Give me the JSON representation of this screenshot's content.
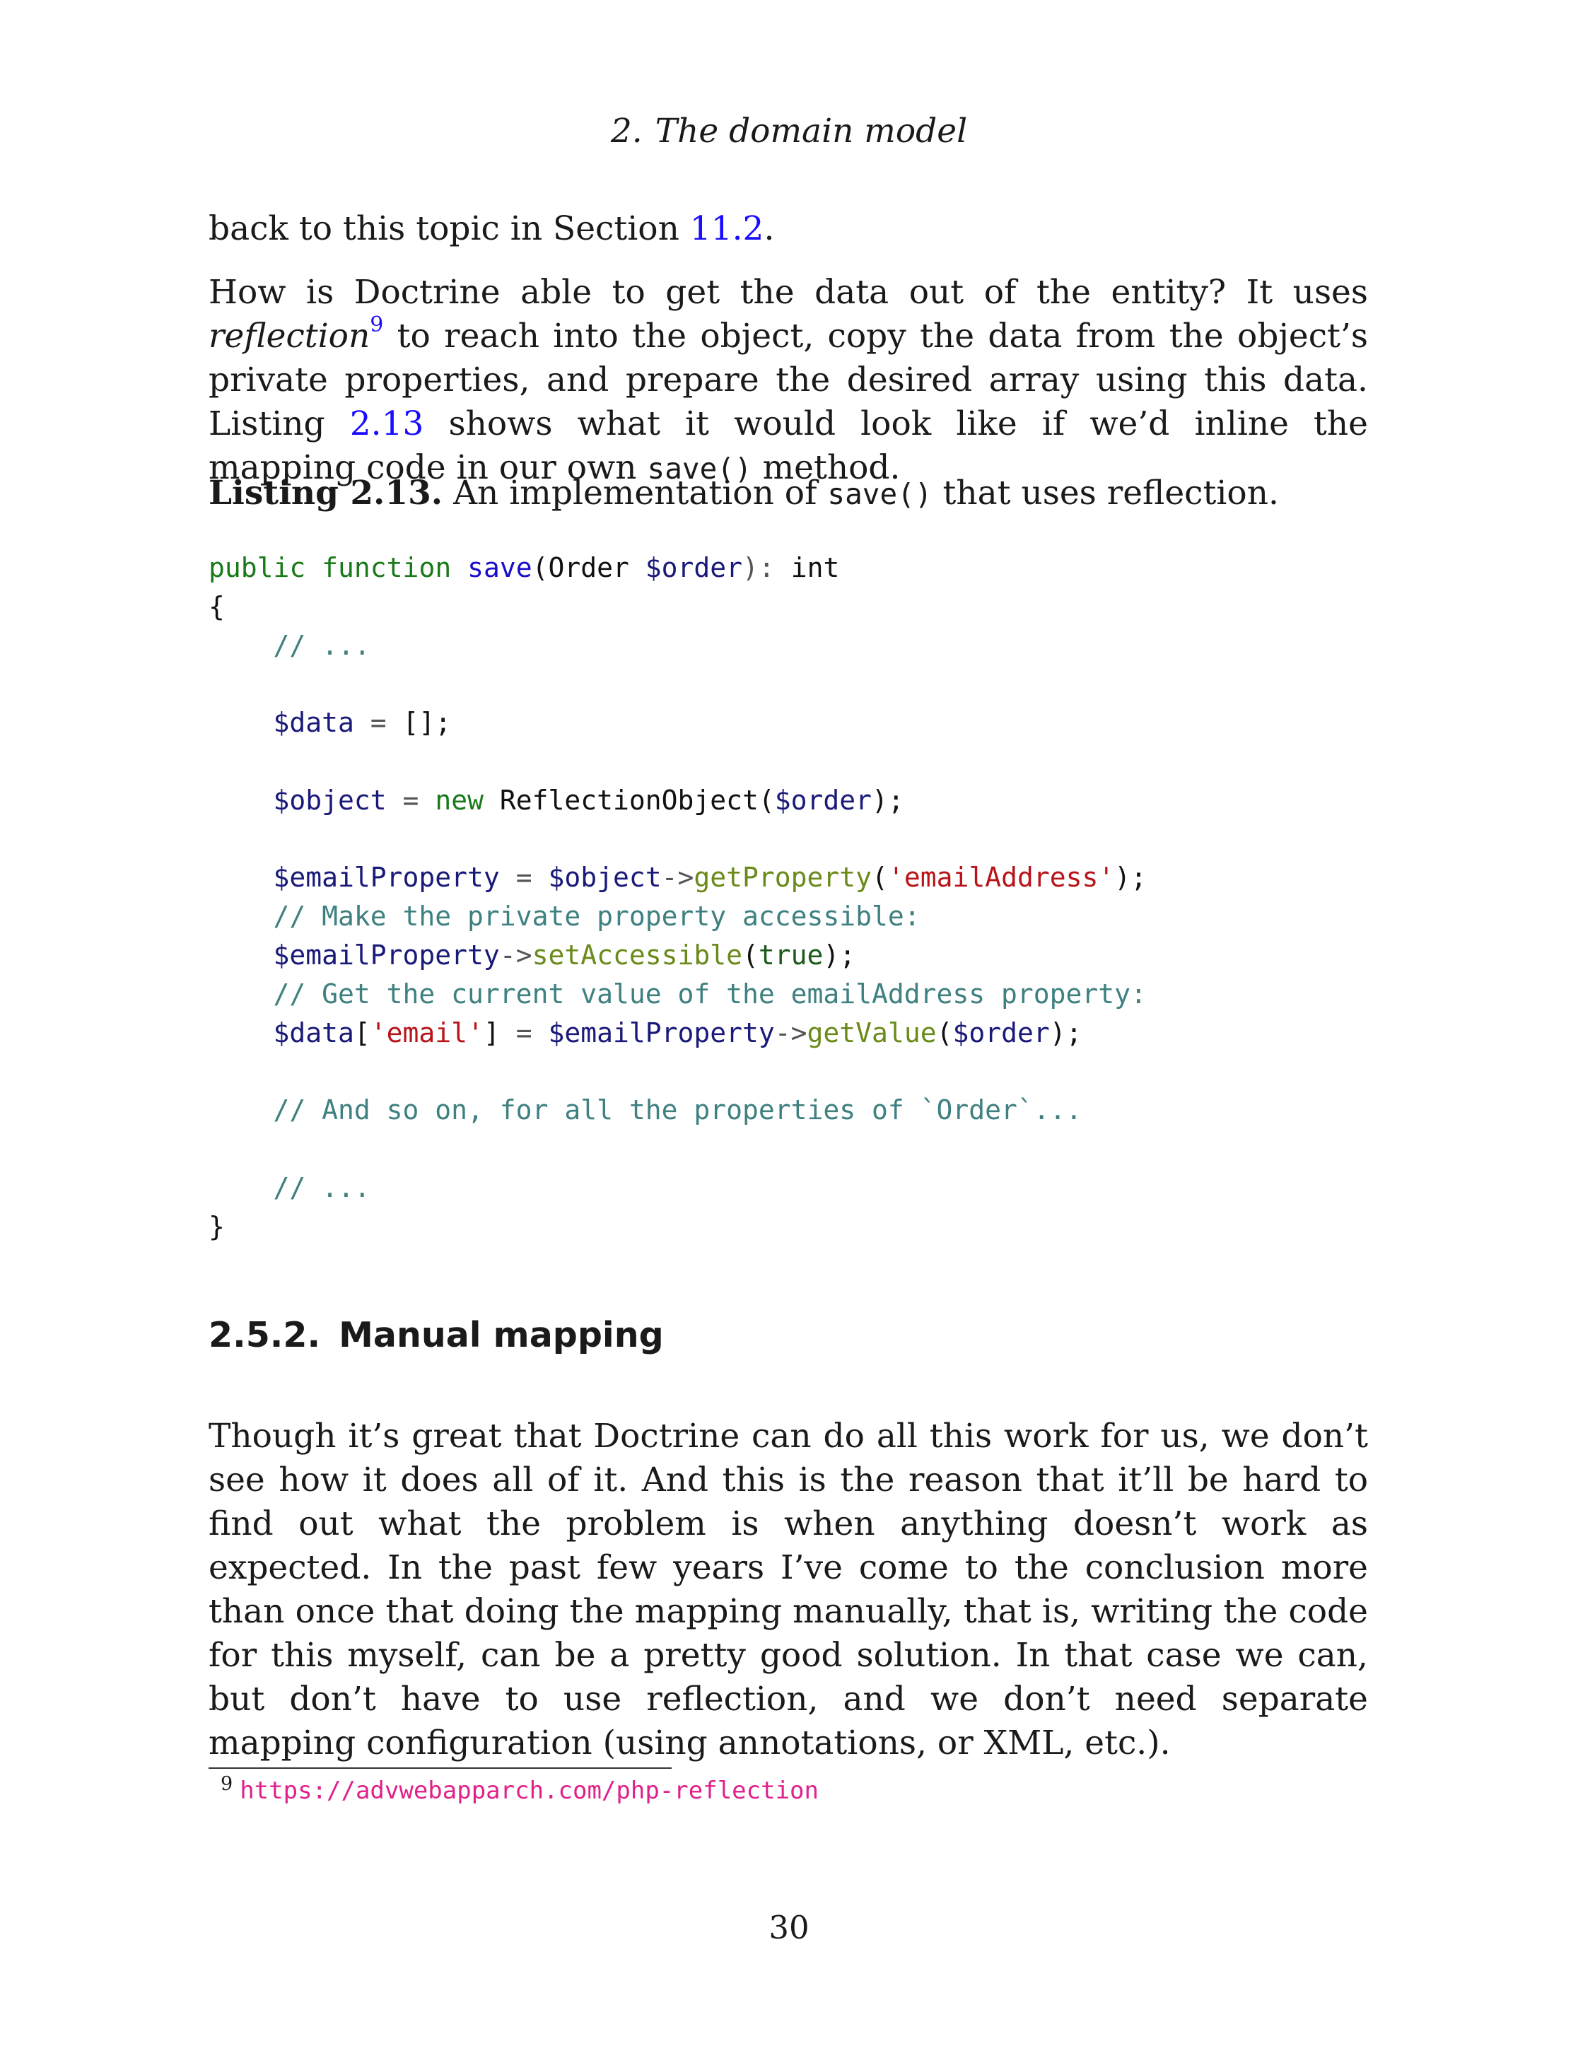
{
  "header": {
    "chapter_number": "2.",
    "chapter_title": "The domain model"
  },
  "para1": {
    "text": "back to this topic in Section ",
    "link": "11.2",
    "end": "."
  },
  "para2": {
    "t1": "How is Doctrine able to get the data out of the entity?  It uses ",
    "em": "reflection",
    "fn": "9",
    "t2": " to reach into the object, copy the data from the object’s private properties, and prepare the desired array using this data.  Listing ",
    "link": "2.13",
    "t3": " shows what it would look like if we’d inline the mapping code in our own ",
    "code": "save()",
    "t4": " method."
  },
  "listing": {
    "label": "Listing 2.13.",
    "t1": " An implementation of ",
    "code": "save()",
    "t2": " that uses reflection."
  },
  "code": {
    "l1_kw1": "public",
    "l1_kw2": "function",
    "l1_fn": "save",
    "l1_p1": "(Order ",
    "l1_var": "$order",
    "l1_p2": "): ",
    "l1_type": "int",
    "l2": "{",
    "l3": "// ...",
    "l5_var": "$data",
    "l5_op": " = ",
    "l5_rest": "[];",
    "l7_var": "$object",
    "l7_op": " = ",
    "l7_new": "new",
    "l7_cls": " ReflectionObject(",
    "l7_arg": "$order",
    "l7_end": ");",
    "l9_var": "$emailProperty",
    "l9_op": " = ",
    "l9_obj": "$object",
    "l9_arrow": "->",
    "l9_meth": "getProperty",
    "l9_p": "(",
    "l9_str": "'emailAddress'",
    "l9_end": ");",
    "l10": "// Make the private property accessible:",
    "l11_var": "$emailProperty",
    "l11_arrow": "->",
    "l11_meth": "setAccessible",
    "l11_p": "(",
    "l11_true": "true",
    "l11_end": ");",
    "l12": "// Get the current value of the emailAddress property:",
    "l13_var": "$data",
    "l13_b1": "[",
    "l13_str": "'email'",
    "l13_b2": "]",
    "l13_op": " = ",
    "l13_obj": "$emailProperty",
    "l13_arrow": "->",
    "l13_meth": "getValue",
    "l13_p": "(",
    "l13_arg": "$order",
    "l13_end": ");",
    "l15": "// And so on, for all the properties of `Order`...",
    "l17": "// ...",
    "l18": "}"
  },
  "section": {
    "number": "2.5.2.",
    "title": "Manual mapping"
  },
  "para3": "Though it’s great that Doctrine can do all this work for us, we don’t see how it does all of it.  And this is the reason that it’ll be hard to find out what the problem is when anything doesn’t work as expected.  In the past few years I’ve come to the conclusion more than once that doing the mapping manually, that is, writing the code for this myself, can be a pretty good solution. In that case we can, but don’t have to use reflection, and we don’t need separate mapping configuration (using annotations, or XML, etc.).",
  "footnote": {
    "mark": "9",
    "url": "https://advwebapparch.com/php-reflection"
  },
  "page_number": "30"
}
